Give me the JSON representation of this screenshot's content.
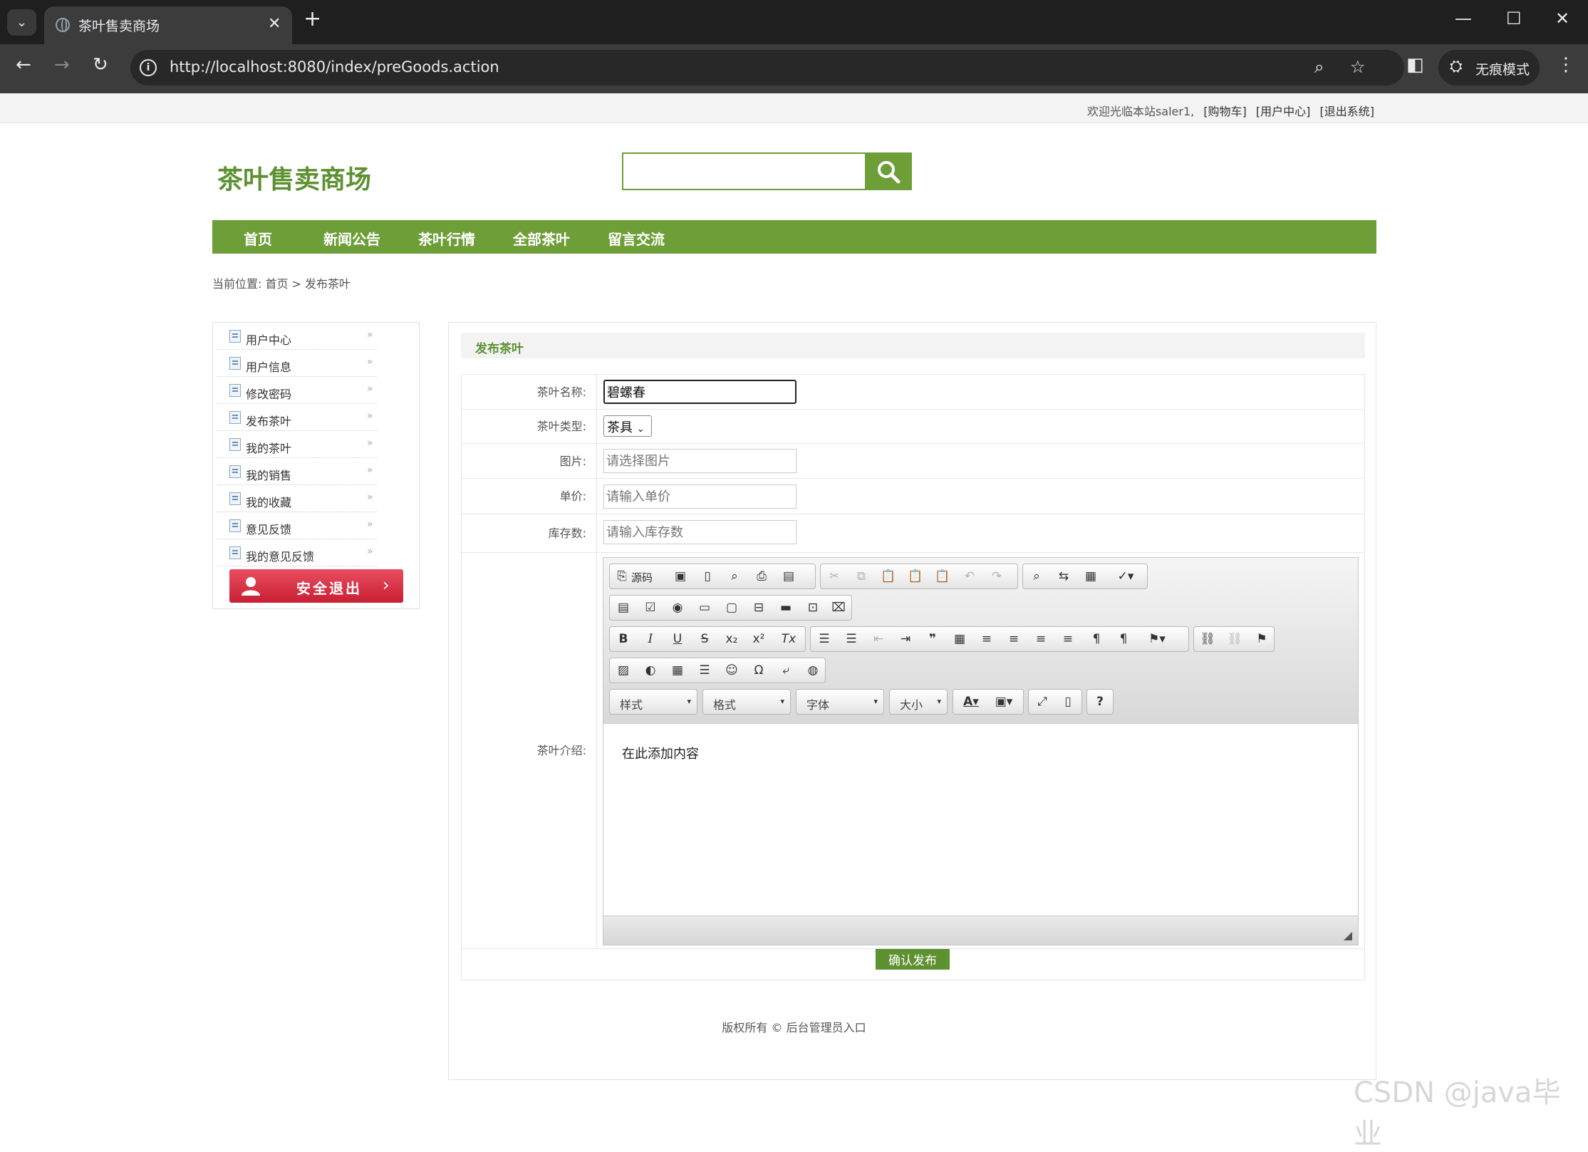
{
  "browser": {
    "tab_title": "茶叶售卖商场",
    "url": "http://localhost:8080/index/preGoods.action",
    "incognito_label": "无痕模式"
  },
  "topbar": {
    "welcome": "欢迎光临本站saler1,",
    "links": [
      "[购物车]",
      "[用户中心]",
      "[退出系统]"
    ]
  },
  "site": {
    "logo": "茶叶售卖商场",
    "search_placeholder": ""
  },
  "nav": [
    "首页",
    "新闻公告",
    "茶叶行情",
    "全部茶叶",
    "留言交流"
  ],
  "breadcrumb": "当前位置: 首页 > 发布茶叶",
  "sidebar": {
    "items": [
      "用户中心",
      "用户信息",
      "修改密码",
      "发布茶叶",
      "我的茶叶",
      "我的销售",
      "我的收藏",
      "意见反馈",
      "我的意见反馈"
    ],
    "logout_label": "安全退出"
  },
  "panel": {
    "title": "发布茶叶"
  },
  "form": {
    "name_label": "茶叶名称:",
    "name_value": "碧螺春",
    "type_label": "茶叶类型:",
    "type_value": "茶具",
    "image_label": "图片:",
    "image_placeholder": "请选择图片",
    "price_label": "单价:",
    "price_placeholder": "请输入单价",
    "stock_label": "库存数:",
    "stock_placeholder": "请输入库存数",
    "intro_label": "茶叶介绍:",
    "submit_label": "确认发布"
  },
  "editor": {
    "source_label": "源码",
    "combo_style": "样式",
    "combo_format": "格式",
    "combo_font": "字体",
    "combo_size": "大小",
    "body_text": "在此添加内容"
  },
  "footer": "版权所有 © 后台管理员入口",
  "watermark": "CSDN @java毕业"
}
